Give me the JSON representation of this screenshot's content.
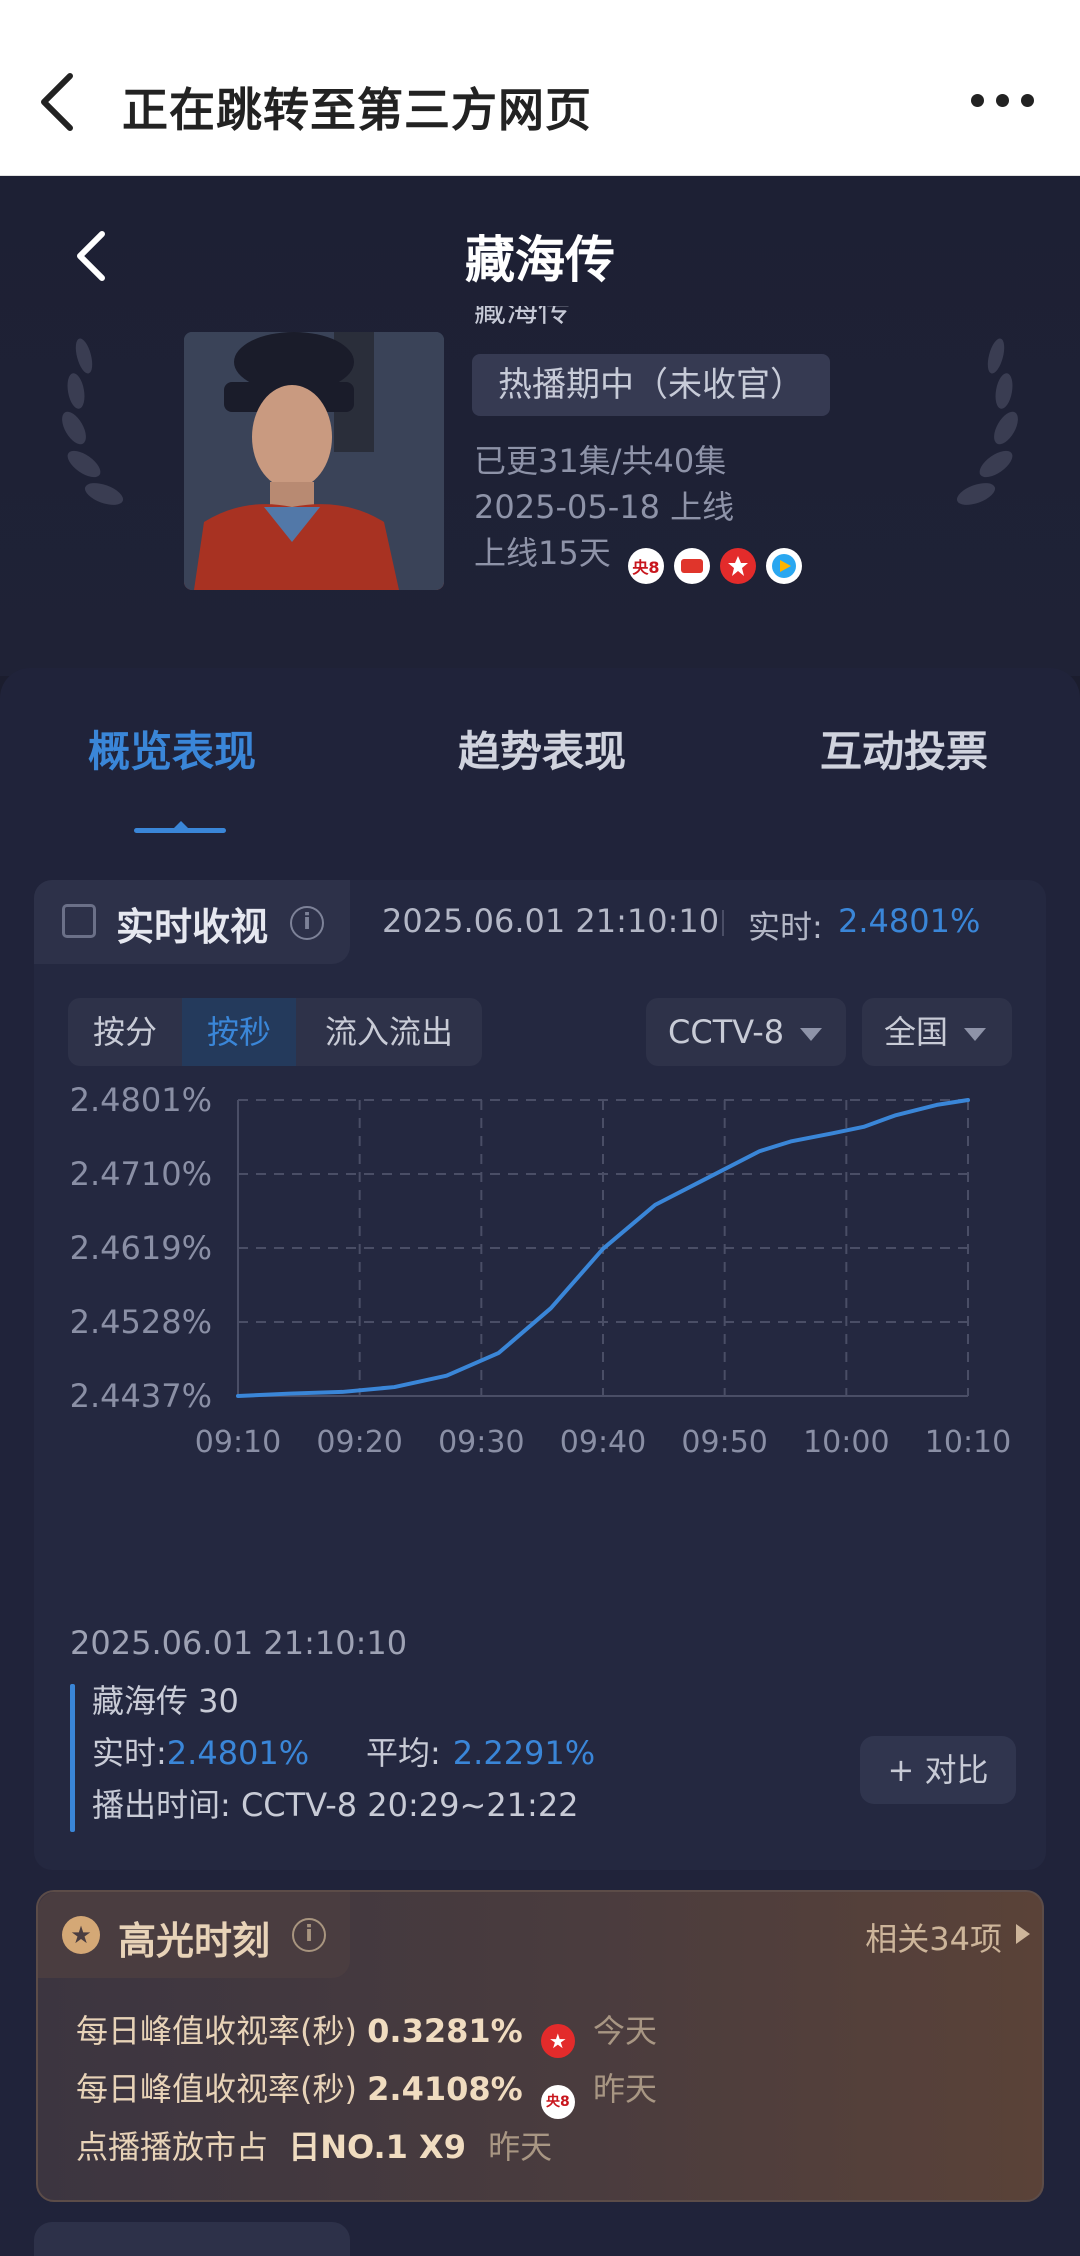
{
  "topbar": {
    "title": "正在跳转至第三方网页"
  },
  "hero": {
    "title": "藏海传",
    "partial_name": "藏海传",
    "status_tag": "热播期中（未收官）",
    "episodes": "已更31集/共40集",
    "release": "2025-05-18 上线",
    "online_days": "上线15天",
    "channels": [
      "央8",
      "腾讯视频",
      "东方卫视",
      "优酷"
    ]
  },
  "tabs": [
    "概览表现",
    "趋势表现",
    "互动投票"
  ],
  "realtime": {
    "header": "实时收视",
    "time": "2025.06.01 21:10:10",
    "label": "实时:",
    "value": "2.4801%",
    "segments": [
      "按分",
      "按秒",
      "流入流出"
    ],
    "channel_select": "CCTV-8",
    "region_select": "全国"
  },
  "chart_data": {
    "type": "line",
    "x": [
      "09:10",
      "09:20",
      "09:30",
      "09:40",
      "09:50",
      "10:00",
      "10:10"
    ],
    "y_ticks": [
      "2.4801%",
      "2.4710%",
      "2.4619%",
      "2.4528%",
      "2.4437%"
    ],
    "ylim": [
      2.4437,
      2.4801
    ],
    "series": [
      {
        "values": [
          2.4437,
          2.444,
          2.4442,
          2.4448,
          2.4462,
          2.449,
          2.4545,
          2.4618,
          2.4672,
          2.4705,
          2.4738,
          2.475,
          2.476,
          2.4768,
          2.4782,
          2.4795,
          2.4801
        ],
        "x_minutes": [
          0,
          5,
          10,
          15,
          20,
          25,
          30,
          35,
          40,
          45,
          50,
          53,
          57,
          60,
          63,
          67,
          70
        ]
      }
    ]
  },
  "detail": {
    "timestamp": "2025.06.01 21:10:10",
    "show": "藏海传 30",
    "realtime_label": "实时:",
    "realtime_value": "2.4801%",
    "avg_label": "平均:",
    "avg_value": "2.2291%",
    "airtime": "播出时间:  CCTV-8 20:29~21:22",
    "compare_button": "+ 对比"
  },
  "highlights": {
    "header": "高光时刻",
    "more": "相关34项",
    "rows": [
      {
        "label": "每日峰值收视率(秒)",
        "value": "0.3281%",
        "when": "今天"
      },
      {
        "label": "每日峰值收视率(秒)",
        "value": "2.4108%",
        "when": "昨天"
      },
      {
        "label": "点播播放市占",
        "value": "日NO.1 X9",
        "when": "昨天"
      }
    ]
  },
  "colors": {
    "accent": "#3a86d8",
    "bg": "#1b1d2e",
    "panel": "#20233a"
  }
}
